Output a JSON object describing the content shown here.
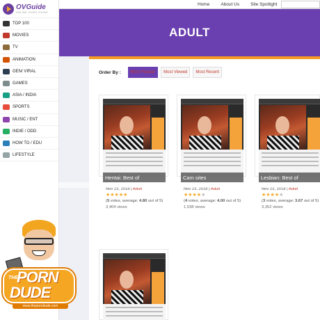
{
  "logo": {
    "name": "OVGuide",
    "tagline": "ONLINE VIDEO GUIDE"
  },
  "sidebar": {
    "items": [
      {
        "label": "TOP 100",
        "icon": "top100-icon",
        "color": "#333333"
      },
      {
        "label": "MOVIES",
        "icon": "movies-icon",
        "color": "#c0392b"
      },
      {
        "label": "TV",
        "icon": "tv-icon",
        "color": "#8e6b3a"
      },
      {
        "label": "ANIMATION",
        "icon": "animation-icon",
        "color": "#d35400"
      },
      {
        "label": "GEN/ VIRAL",
        "icon": "viral-icon",
        "color": "#2c3e50"
      },
      {
        "label": "GAMES",
        "icon": "games-icon",
        "color": "#7f8c8d"
      },
      {
        "label": "ASIA / INDIA",
        "icon": "asia-icon",
        "color": "#16a085"
      },
      {
        "label": "SPORTS",
        "icon": "sports-icon",
        "color": "#e74c3c"
      },
      {
        "label": "MUSIC / ENT",
        "icon": "music-icon",
        "color": "#8e44ad"
      },
      {
        "label": "INDIE / ODD",
        "icon": "indie-icon",
        "color": "#27ae60"
      },
      {
        "label": "HOW TO / EDU",
        "icon": "howto-icon",
        "color": "#2980b9"
      },
      {
        "label": "LIFESTYLE",
        "icon": "lifestyle-icon",
        "color": "#95a5a6"
      }
    ]
  },
  "topnav": {
    "home": "Home",
    "about": "About Us",
    "spotlight": "Site Spotlight"
  },
  "banner": {
    "title": "ADULT",
    "color": "#6a3fb0",
    "accent": "#f59a23"
  },
  "order": {
    "label": "Order By :",
    "options": [
      {
        "label": "Most Popular",
        "active": true
      },
      {
        "label": "Most Viewed",
        "active": false
      },
      {
        "label": "Most Recent",
        "active": false
      }
    ]
  },
  "cards": [
    {
      "title": "Hentai: Best of",
      "date": "Nov 23, 2018",
      "category": "Adult",
      "rating": 4.8,
      "votes": "5",
      "average": "4.80",
      "max": "5",
      "views": "3,404 views"
    },
    {
      "title": "Cam sites",
      "date": "Nov 23, 2018",
      "category": "Adult",
      "rating": 4.0,
      "votes": "4",
      "average": "4.00",
      "max": "5",
      "views": "1,538 views"
    },
    {
      "title": "Lesbian: Best of",
      "date": "Nov 23, 2018",
      "category": "Adult",
      "rating": 3.67,
      "votes": "3",
      "average": "3.67",
      "max": "5",
      "views": "3,352 views"
    },
    {
      "title": "",
      "date": "",
      "category": "",
      "rating": 0,
      "votes": "",
      "average": "",
      "max": "",
      "views": ""
    }
  ],
  "badge": {
    "the": "THE",
    "porn": "PORN",
    "dude": "DUDE",
    "url": "www.theporndude.com"
  }
}
